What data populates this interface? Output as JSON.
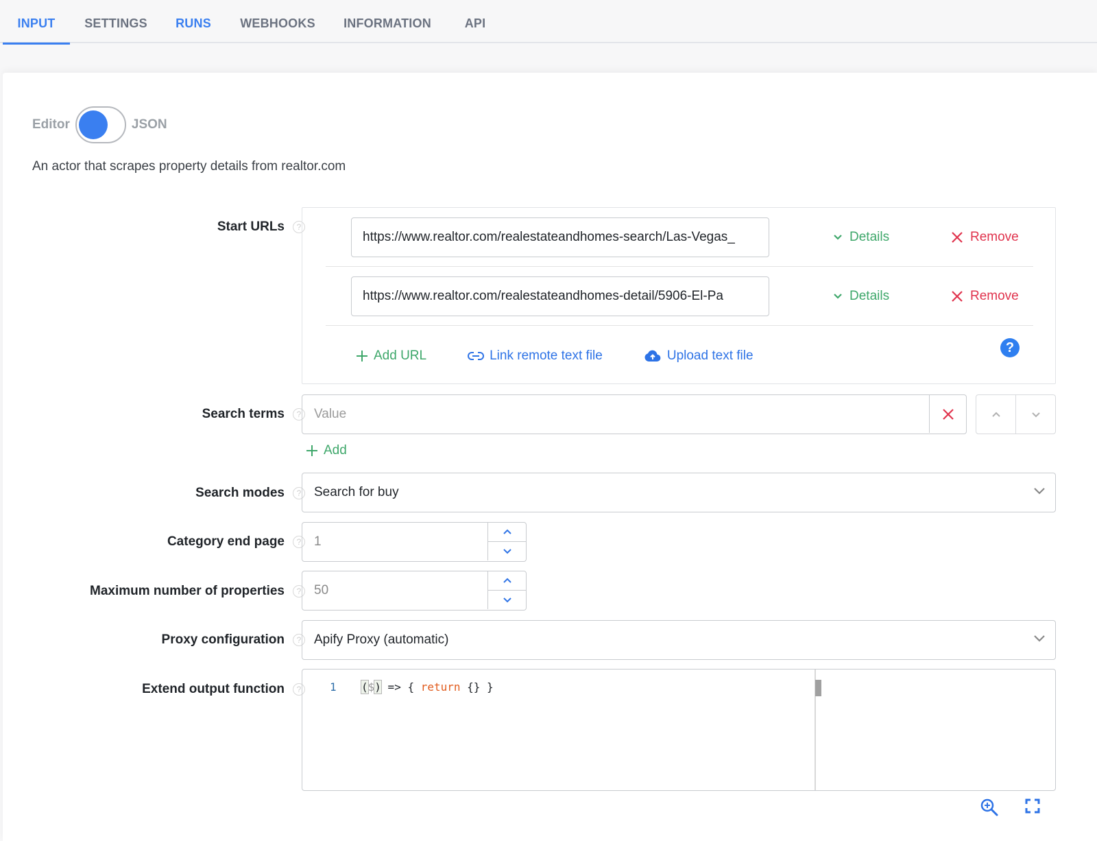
{
  "tabs": [
    {
      "label": "INPUT",
      "active": true
    },
    {
      "label": "SETTINGS",
      "active": false
    },
    {
      "label": "RUNS",
      "active": false
    },
    {
      "label": "WEBHOOKS",
      "active": false
    },
    {
      "label": "INFORMATION",
      "active": false
    },
    {
      "label": "API",
      "active": false
    }
  ],
  "colors": {
    "accent": "#3a7ff0",
    "success": "#3ea76a",
    "danger": "#e0334d",
    "link": "#2e73e6"
  },
  "mode_toggle": {
    "left_label": "Editor",
    "right_label": "JSON",
    "selected": "Editor"
  },
  "description": "An actor that scrapes property details from realtor.com",
  "fields": {
    "start_urls": {
      "label": "Start URLs",
      "items": [
        {
          "url": "https://www.realtor.com/realestateandhomes-search/Las-Vegas_",
          "details_label": "Details",
          "remove_label": "Remove"
        },
        {
          "url": "https://www.realtor.com/realestateandhomes-detail/5906-El-Pa",
          "details_label": "Details",
          "remove_label": "Remove"
        }
      ],
      "add_url_label": "Add URL",
      "link_remote_label": "Link remote text file",
      "upload_label": "Upload text file",
      "help_icon": "?"
    },
    "search_terms": {
      "label": "Search terms",
      "placeholder": "Value",
      "add_label": "Add"
    },
    "search_modes": {
      "label": "Search modes",
      "value": "Search for buy"
    },
    "category_end_page": {
      "label": "Category end page",
      "value": "1"
    },
    "max_properties": {
      "label": "Maximum number of properties",
      "value": "50"
    },
    "proxy_configuration": {
      "label": "Proxy configuration",
      "value": "Apify Proxy (automatic)"
    },
    "extend_output_function": {
      "label": "Extend output function",
      "line_number": "1",
      "code": {
        "open_paren": "(",
        "param": "$",
        "close_paren": ")",
        "arrow": " => { ",
        "keyword": "return",
        "rest": " {} }"
      }
    }
  },
  "help_glyph": "?"
}
